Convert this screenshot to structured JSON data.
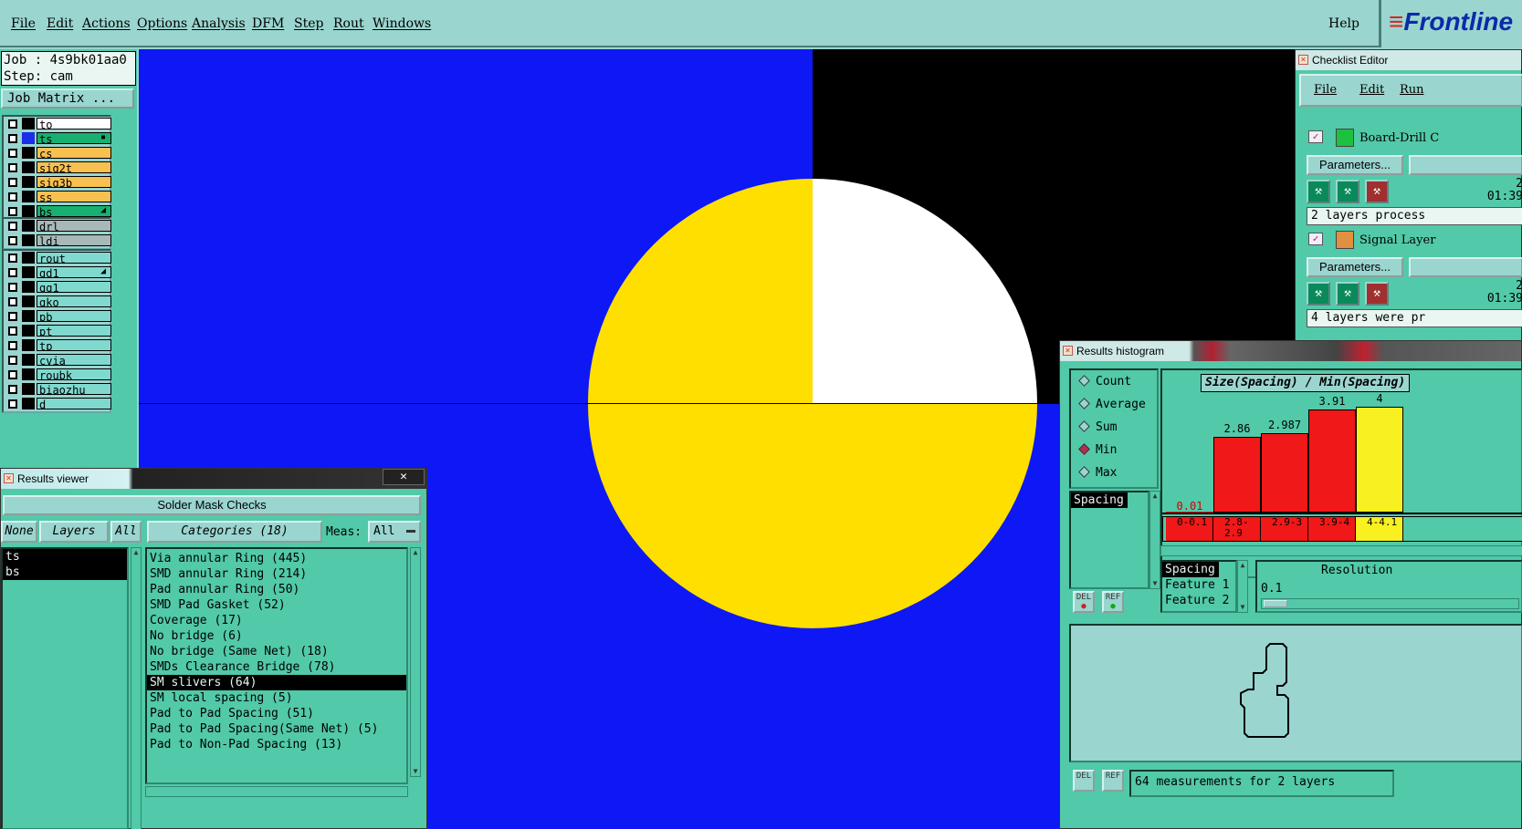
{
  "menu": {
    "items": [
      "File",
      "Edit",
      "Actions",
      "Options",
      "Analysis",
      "DFM",
      "Step",
      "Rout",
      "Windows"
    ],
    "help": "Help",
    "logo": "Frontline"
  },
  "job": {
    "job_line": "Job : 4s9bk01aa0",
    "step_line": "Step: cam",
    "matrix_button": "Job Matrix ..."
  },
  "layers": {
    "group1": [
      {
        "name": "to",
        "color": "#ffffff",
        "swatch": "#000000"
      },
      {
        "name": "ts",
        "color": "#18b070",
        "swatch": "#1a2de8",
        "mark": "▪"
      },
      {
        "name": "cs",
        "color": "#f8c050",
        "swatch": "#000000"
      },
      {
        "name": "sig2t",
        "color": "#f8c050",
        "swatch": "#000000"
      },
      {
        "name": "sig3b",
        "color": "#f8c050",
        "swatch": "#000000"
      },
      {
        "name": "ss",
        "color": "#f8c050",
        "swatch": "#000000"
      },
      {
        "name": "bs",
        "color": "#18b070",
        "swatch": "#000000",
        "mark": "◢"
      }
    ],
    "group2": [
      {
        "name": "drl",
        "color": "#a8b8b8",
        "swatch": "#000000"
      },
      {
        "name": "ldi",
        "color": "#a8b8b8",
        "swatch": "#000000"
      }
    ],
    "group3": [
      {
        "name": "rout",
        "color": "#7fd9cf",
        "swatch": "#000000"
      },
      {
        "name": "gd1",
        "color": "#7fd9cf",
        "swatch": "#000000",
        "mark": "◢"
      },
      {
        "name": "gg1",
        "color": "#7fd9cf",
        "swatch": "#000000"
      },
      {
        "name": "gko",
        "color": "#7fd9cf",
        "swatch": "#000000"
      },
      {
        "name": "pb",
        "color": "#7fd9cf",
        "swatch": "#000000"
      },
      {
        "name": "pt",
        "color": "#7fd9cf",
        "swatch": "#000000"
      },
      {
        "name": "tp",
        "color": "#7fd9cf",
        "swatch": "#000000"
      },
      {
        "name": "cvia",
        "color": "#7fd9cf",
        "swatch": "#000000"
      },
      {
        "name": "roubk",
        "color": "#7fd9cf",
        "swatch": "#000000"
      },
      {
        "name": "biaozhu",
        "color": "#7fd9cf",
        "swatch": "#000000"
      },
      {
        "name": "d",
        "color": "#7fd9cf",
        "swatch": "#000000"
      }
    ]
  },
  "results_viewer": {
    "title": "Results viewer",
    "close": "✕",
    "header": "Solder Mask Checks",
    "none_btn": "None",
    "layers_btn": "Layers",
    "all_btn": "All",
    "categories_btn": "Categories (18)",
    "meas_label": "Meas:",
    "meas_value": "All",
    "layer_list": [
      {
        "label": "ts",
        "selected": true
      },
      {
        "label": "bs",
        "selected": true
      }
    ],
    "categories": [
      {
        "label": "Via annular Ring (445)"
      },
      {
        "label": "SMD annular Ring (214)"
      },
      {
        "label": "Pad annular Ring (50)"
      },
      {
        "label": "SMD Pad Gasket (52)"
      },
      {
        "label": "Coverage (17)"
      },
      {
        "label": "No bridge (6)"
      },
      {
        "label": "No bridge (Same Net) (18)"
      },
      {
        "label": "SMDs Clearance Bridge (78)"
      },
      {
        "label": "SM slivers (64)",
        "selected": true
      },
      {
        "label": "SM local spacing (5)"
      },
      {
        "label": "Pad to Pad Spacing (51)"
      },
      {
        "label": "Pad to Pad Spacing(Same Net) (5)"
      },
      {
        "label": "Pad to Non-Pad Spacing (13)"
      }
    ]
  },
  "checklist": {
    "title": "Checklist Editor",
    "menu": [
      "File",
      "Edit",
      "Run"
    ],
    "items": [
      {
        "name": "Board-Drill C",
        "params": "Parameters...",
        "time_line1": "2",
        "time_line2": "01:39",
        "status": "2 layers process"
      },
      {
        "name": "Signal Layer",
        "params": "Parameters...",
        "time_line1": "2",
        "time_line2": "01:39",
        "status": "4 layers were pr"
      }
    ]
  },
  "histogram": {
    "title": "Results histogram",
    "modes": [
      {
        "label": "Count",
        "on": false
      },
      {
        "label": "Average",
        "on": false
      },
      {
        "label": "Sum",
        "on": false
      },
      {
        "label": "Min",
        "on": true
      },
      {
        "label": "Max",
        "on": false
      }
    ],
    "measure_list": [
      "Spacing"
    ],
    "del_btn": "DEL",
    "ref_btn": "REF",
    "plot_title": "Size(Spacing) / Min(Spacing)",
    "bins": [
      {
        "label": "0-0.1",
        "value": 0.01,
        "value_label": "0.01",
        "color": "#f01818"
      },
      {
        "label": "2.8-2.9",
        "value": 2.86,
        "value_label": "2.86",
        "color": "#f01818"
      },
      {
        "label": "2.9-3",
        "value": 2.987,
        "value_label": "2.987",
        "color": "#f01818"
      },
      {
        "label": "3.9-4",
        "value": 3.91,
        "value_label": "3.91",
        "color": "#f01818"
      },
      {
        "label": "4-4.1",
        "value": 4,
        "value_label": "4",
        "color": "#f8f020"
      }
    ],
    "y_max": 4,
    "axis_list": [
      "Spacing",
      "Feature 1",
      "Feature 2"
    ],
    "resolution_label": "Resolution",
    "resolution_value": "0.1",
    "footer_text": "64 measurements for 2 layers"
  },
  "colors": {
    "canvas_bg": "#0d18f5",
    "pad_yellow": "#ffdf00",
    "pad_white": "#ffffff",
    "panel_teal": "#52c9a8",
    "panel_light": "#9ad5cf"
  }
}
